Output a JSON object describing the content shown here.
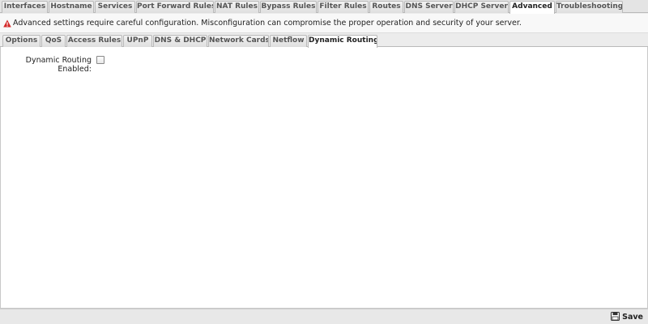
{
  "top_tabs": [
    {
      "label": "Interfaces",
      "active": false
    },
    {
      "label": "Hostname",
      "active": false
    },
    {
      "label": "Services",
      "active": false
    },
    {
      "label": "Port Forward Rules",
      "active": false
    },
    {
      "label": "NAT Rules",
      "active": false
    },
    {
      "label": "Bypass Rules",
      "active": false
    },
    {
      "label": "Filter Rules",
      "active": false
    },
    {
      "label": "Routes",
      "active": false
    },
    {
      "label": "DNS Server",
      "active": false
    },
    {
      "label": "DHCP Server",
      "active": false
    },
    {
      "label": "Advanced",
      "active": true
    },
    {
      "label": "Troubleshooting",
      "active": false
    }
  ],
  "warning": {
    "icon": "warning-triangle-icon",
    "text": "Advanced settings require careful configuration. Misconfiguration can compromise the proper operation and security of your server."
  },
  "sub_tabs": [
    {
      "label": "Options",
      "active": false
    },
    {
      "label": "QoS",
      "active": false
    },
    {
      "label": "Access Rules",
      "active": false
    },
    {
      "label": "UPnP",
      "active": false
    },
    {
      "label": "DNS & DHCP",
      "active": false
    },
    {
      "label": "Network Cards",
      "active": false
    },
    {
      "label": "Netflow",
      "active": false
    },
    {
      "label": "Dynamic Routing",
      "active": true
    }
  ],
  "form": {
    "dynamic_routing_label": "Dynamic Routing Enabled:",
    "dynamic_routing_checked": false
  },
  "footer": {
    "save_label": "Save",
    "save_icon": "floppy-disk-icon"
  },
  "colors": {
    "warning_icon": "#d42a2a",
    "active_tab_bg": "#ffffff"
  }
}
